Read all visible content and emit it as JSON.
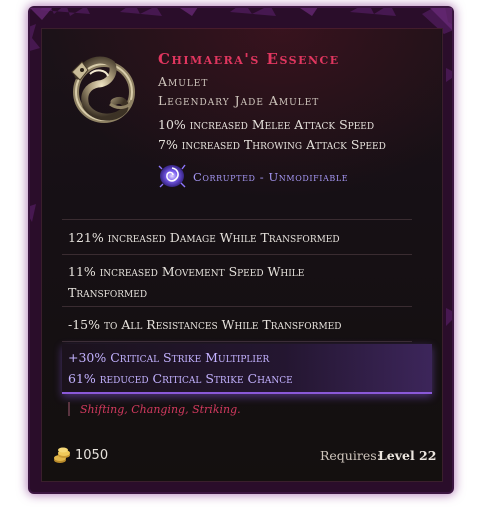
{
  "item": {
    "name": "Chimaera's Essence",
    "type": "Amulet",
    "base": "Legendary Jade Amulet",
    "implicits": [
      "10% increased Melee Attack Speed",
      "7% increased Throwing Attack Speed"
    ],
    "corrupted": "Corrupted - Unmodifiable",
    "affixes": [
      "121% increased Damage While Transformed",
      "11% increased Movement Speed While",
      "Transformed",
      "-15% to All Resistances While Transformed"
    ],
    "crit_affixes": [
      "+30% Critical Strike Multiplier",
      "61% reduced Critical Strike Chance"
    ],
    "flavor": "Shifting, Changing, Striking.",
    "gold": "1050",
    "requires_label": "Requires:",
    "requires_value": "Level 22"
  },
  "colors": {
    "name": "#e0365f",
    "corrupted": "#a496f2",
    "crit": "#c3b2ff",
    "flavor": "#d0395e"
  },
  "icons": {
    "item": "jade-amulet-icon",
    "corrupted": "corruption-swirl-icon",
    "currency": "gold-coins-icon"
  }
}
